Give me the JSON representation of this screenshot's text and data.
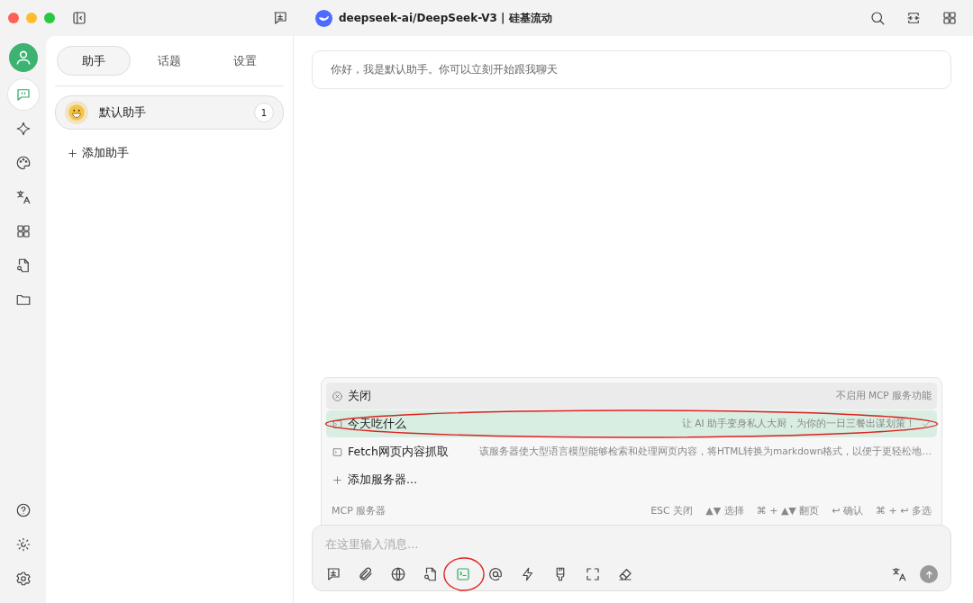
{
  "window": {
    "title": "deepseek-ai/DeepSeek-V3 | 硅基流动"
  },
  "nav_rail": {
    "top": [
      {
        "selected": true
      },
      {
        "selected": false
      },
      {
        "selected": false
      },
      {
        "selected": false
      },
      {
        "selected": false
      },
      {
        "selected": false
      },
      {
        "selected": false
      }
    ],
    "bottom": [
      {
        "selected": false
      },
      {
        "selected": false
      },
      {
        "selected": false
      }
    ]
  },
  "sidebar": {
    "tabs": [
      {
        "label": "助手",
        "selected": true
      },
      {
        "label": "话题",
        "selected": false
      },
      {
        "label": "设置",
        "selected": false
      }
    ],
    "assistants": [
      {
        "name": "默认助手",
        "count": "1",
        "selected": true
      }
    ],
    "add_label": "添加助手"
  },
  "chat": {
    "greeting": "你好，我是默认助手。你可以立刻开始跟我聊天"
  },
  "mcp_menu": {
    "items": [
      {
        "kind": "close",
        "label": "关闭",
        "description": "不启用 MCP 服务功能",
        "focused": true,
        "selected": false,
        "circled": false
      },
      {
        "kind": "server",
        "label": "今天吃什么",
        "description": "让 AI 助手变身私人大厨，为你的一日三餐出谋划策！",
        "focused": false,
        "selected": true,
        "circled": true
      },
      {
        "kind": "server",
        "label": "Fetch网页内容抓取",
        "description": "该服务器使大型语言模型能够检索和处理网页内容，将HTML转换为markdown格式，以便于更轻松地…",
        "focused": false,
        "selected": false,
        "circled": false
      },
      {
        "kind": "add",
        "label": "添加服务器...",
        "focused": false,
        "selected": false,
        "circled": false
      }
    ],
    "footer_title": "MCP 服务器",
    "hints": [
      "ESC 关闭",
      "▲▼ 选择",
      "⌘ + ▲▼ 翻页",
      "↩ 确认",
      "⌘ + ↩ 多选"
    ]
  },
  "input": {
    "placeholder": "在这里输入消息...",
    "tools": [
      {
        "active": false,
        "circled": false
      },
      {
        "active": false,
        "circled": false
      },
      {
        "active": false,
        "circled": false
      },
      {
        "active": false,
        "circled": false
      },
      {
        "active": true,
        "circled": true
      },
      {
        "active": false,
        "circled": false
      },
      {
        "active": false,
        "circled": false
      },
      {
        "active": false,
        "circled": false
      },
      {
        "active": false,
        "circled": false
      },
      {
        "active": false,
        "circled": false
      }
    ]
  }
}
